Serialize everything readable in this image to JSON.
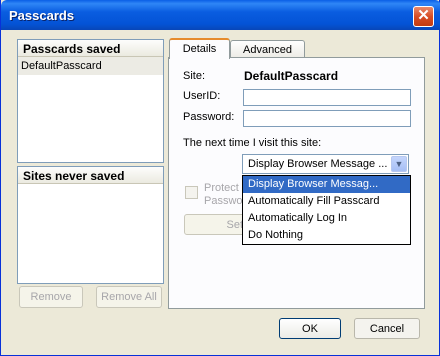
{
  "window": {
    "title": "Passcards",
    "close_glyph": "✕"
  },
  "left": {
    "saved_header": "Passcards saved",
    "saved_items": [
      "DefaultPasscard"
    ],
    "never_header": "Sites never saved",
    "remove_label": "Remove",
    "remove_all_label": "Remove All"
  },
  "tabs": {
    "details": "Details",
    "advanced": "Advanced"
  },
  "details": {
    "site_label": "Site:",
    "site_value": "DefaultPasscard",
    "userid_label": "UserID:",
    "password_label": "Password:",
    "next_time_label": "The next time I visit this site:",
    "select_value": "Display Browser Message ...",
    "protect_text_1": "Protect",
    "protect_text_2": "Passwo",
    "set_label": "Set"
  },
  "dropdown_options": [
    "Display Browser Messag...",
    "Automatically Fill Passcard",
    "Automatically Log In",
    "Do Nothing"
  ],
  "footer": {
    "ok_label": "OK",
    "cancel_label": "Cancel"
  }
}
